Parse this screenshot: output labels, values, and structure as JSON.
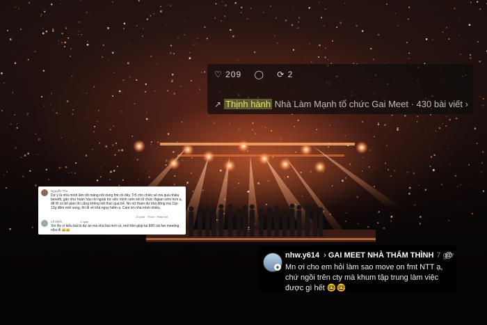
{
  "trending": {
    "stats": [
      "♡ 209",
      "◯",
      "⟳ 2"
    ],
    "label": "Thịnh hành",
    "topic": "Nhà Làm Mạnh tổ chức Gai Meet · 430 bài viết",
    "chevron": "›"
  },
  "fb_comment": {
    "comment1": "Dự ý là nhà mình làm tốt mảng nội dung fmt rồi đấy. Tr5 cho chiếc vé mà quá nhiều benefit, gần như hoàn hảo rồi ngoài trừ việc mình xem xét tổ chức thgian sớm hơn ạ, để lỡ có bế plan thì cũng không kết thúc quá trễ. Nn nữ tham dự khá đông mà 11p-12g đêm mới xong, thì đi về khá nguy hiểm ạ. Cám ơn nhà mình nhiều.",
    "name1": "Nguyễn Thu",
    "meta1": "23 phút · Thích · Phản hồi",
    "name2": "Lê Minh",
    "comment2": "Xin lỗy vì kiểu bài là dự án mà nhà bài mới có, mới liền giúp tui 800 cái fan meeting nữa đi 😹😹",
    "meta2": "1 ngày"
  },
  "threads_post": {
    "username": "nhw.y614",
    "arrow": "›",
    "group": "GAI MEET NHÀ THẨM THÌNH",
    "time": "7 giờ",
    "body": "Mn ơi cho em hỏi làm sao move on fmt NTT ạ, chứ ngồi trên cty mà khum tập trung làm việc được gì hết 🤓🤓",
    "logo": "@"
  },
  "colors": {
    "stage_glow": "#ff7a3c",
    "highlight": "#e6e07a"
  }
}
